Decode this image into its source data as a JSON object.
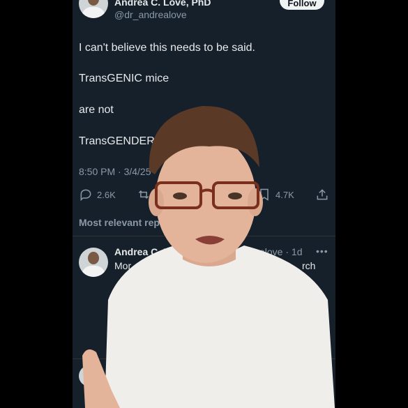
{
  "author": {
    "name": "Andrea C. Love, PhD",
    "handle": "@dr_andrealove",
    "follow_label": "Follow"
  },
  "tweet": {
    "lines": [
      "I can't believe this needs to be said.",
      "TransGENIC mice",
      "are not",
      "TransGENDER"
    ],
    "meta": "8:50 PM · 3/4/25"
  },
  "actions": {
    "replies": "2.6K",
    "bookmarks": "4.7K"
  },
  "replies_section": {
    "sort_label": "Most relevant repl",
    "reply": {
      "name": "Andrea C. L",
      "handle_tail": "elove · 1d",
      "text_left": "Mor",
      "text_right": "rch"
    }
  },
  "colors": {
    "background": "#15202b",
    "muted": "#8b98a5",
    "text": "#e7e9ea"
  }
}
